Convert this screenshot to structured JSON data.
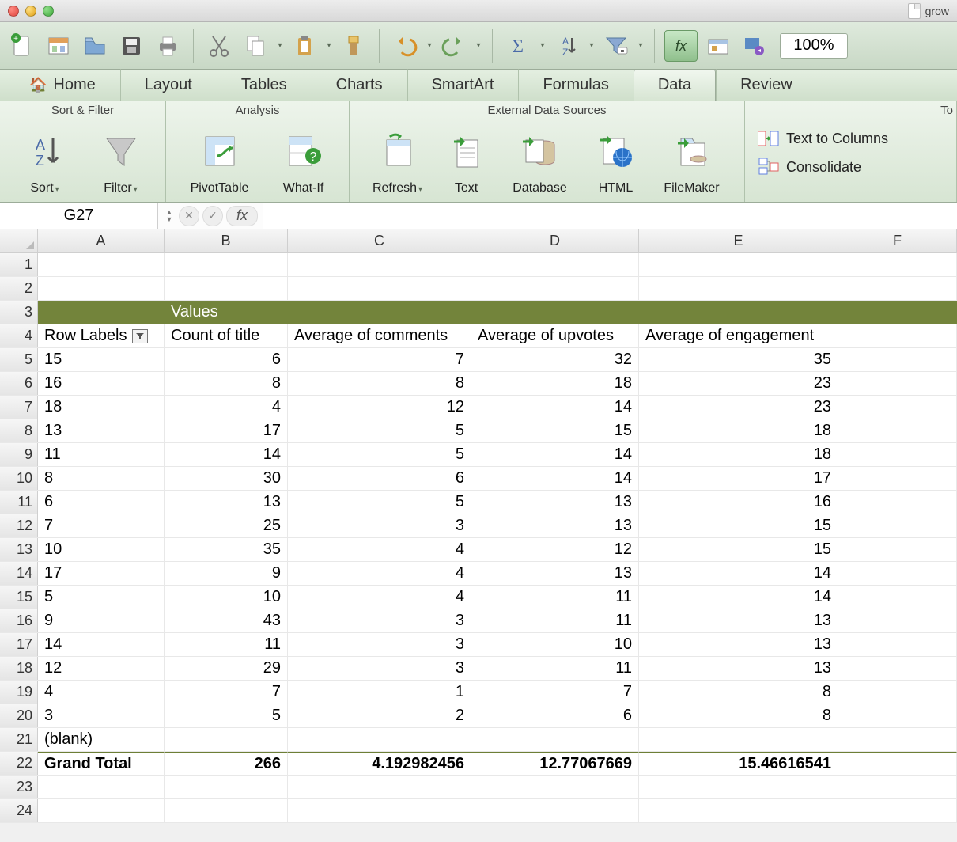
{
  "window": {
    "title": "grow"
  },
  "toolbar": {
    "zoom": "100%"
  },
  "ribbon_tabs": [
    "Home",
    "Layout",
    "Tables",
    "Charts",
    "SmartArt",
    "Formulas",
    "Data",
    "Review"
  ],
  "active_tab_index": 6,
  "ribbon": {
    "group1": {
      "title": "Sort & Filter",
      "sort": "Sort",
      "filter": "Filter"
    },
    "group2": {
      "title": "Analysis",
      "pivot": "PivotTable",
      "whatif": "What-If"
    },
    "group3": {
      "title": "External Data Sources",
      "refresh": "Refresh",
      "text": "Text",
      "database": "Database",
      "html": "HTML",
      "filemaker": "FileMaker"
    },
    "group4": {
      "title": "To",
      "t2c": "Text to Columns",
      "cons": "Consolidate"
    }
  },
  "namebox": "G27",
  "columns": [
    "A",
    "B",
    "C",
    "D",
    "E",
    "F"
  ],
  "pivot": {
    "values_hdr": "Values",
    "headers": [
      "Row Labels",
      "Count of title",
      "Average of comments",
      "Average of upvotes",
      "Average of engagement"
    ],
    "rows": [
      [
        "15",
        "6",
        "7",
        "32",
        "35"
      ],
      [
        "16",
        "8",
        "8",
        "18",
        "23"
      ],
      [
        "18",
        "4",
        "12",
        "14",
        "23"
      ],
      [
        "13",
        "17",
        "5",
        "15",
        "18"
      ],
      [
        "11",
        "14",
        "5",
        "14",
        "18"
      ],
      [
        "8",
        "30",
        "6",
        "14",
        "17"
      ],
      [
        "6",
        "13",
        "5",
        "13",
        "16"
      ],
      [
        "7",
        "25",
        "3",
        "13",
        "15"
      ],
      [
        "10",
        "35",
        "4",
        "12",
        "15"
      ],
      [
        "17",
        "9",
        "4",
        "13",
        "14"
      ],
      [
        "5",
        "10",
        "4",
        "11",
        "14"
      ],
      [
        "9",
        "43",
        "3",
        "11",
        "13"
      ],
      [
        "14",
        "11",
        "3",
        "10",
        "13"
      ],
      [
        "12",
        "29",
        "3",
        "11",
        "13"
      ],
      [
        "4",
        "7",
        "1",
        "7",
        "8"
      ],
      [
        "3",
        "5",
        "2",
        "6",
        "8"
      ]
    ],
    "blank_label": "(blank)",
    "grand_total": {
      "label": "Grand Total",
      "b": "266",
      "c": "4.192982456",
      "d": "12.77067669",
      "e": "15.46616541"
    }
  }
}
